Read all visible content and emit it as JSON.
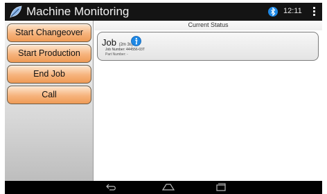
{
  "actionbar": {
    "title": "Machine Monitoring",
    "clock": "12:11",
    "app_icon": "leaf-icon",
    "status_icons": [
      "bluetooth-icon",
      "overflow-menu-icon"
    ]
  },
  "sidebar": {
    "buttons": [
      {
        "label": "Start Changeover"
      },
      {
        "label": "Start Production"
      },
      {
        "label": "End Job"
      },
      {
        "label": "Call"
      }
    ]
  },
  "main": {
    "header": "Current Status",
    "job": {
      "title": "Job",
      "duration": "(2m 3s)",
      "job_number": "Job Number: 444556-03T",
      "part_number": "Part Number: -"
    }
  },
  "navbar": {
    "icons": [
      "back-icon",
      "home-icon",
      "recent-apps-icon"
    ]
  },
  "colors": {
    "button_gradient_top": "#fde6cf",
    "button_gradient_bottom": "#ef9b56",
    "bar_background": "#141414",
    "info_blue": "#1e88e5"
  }
}
